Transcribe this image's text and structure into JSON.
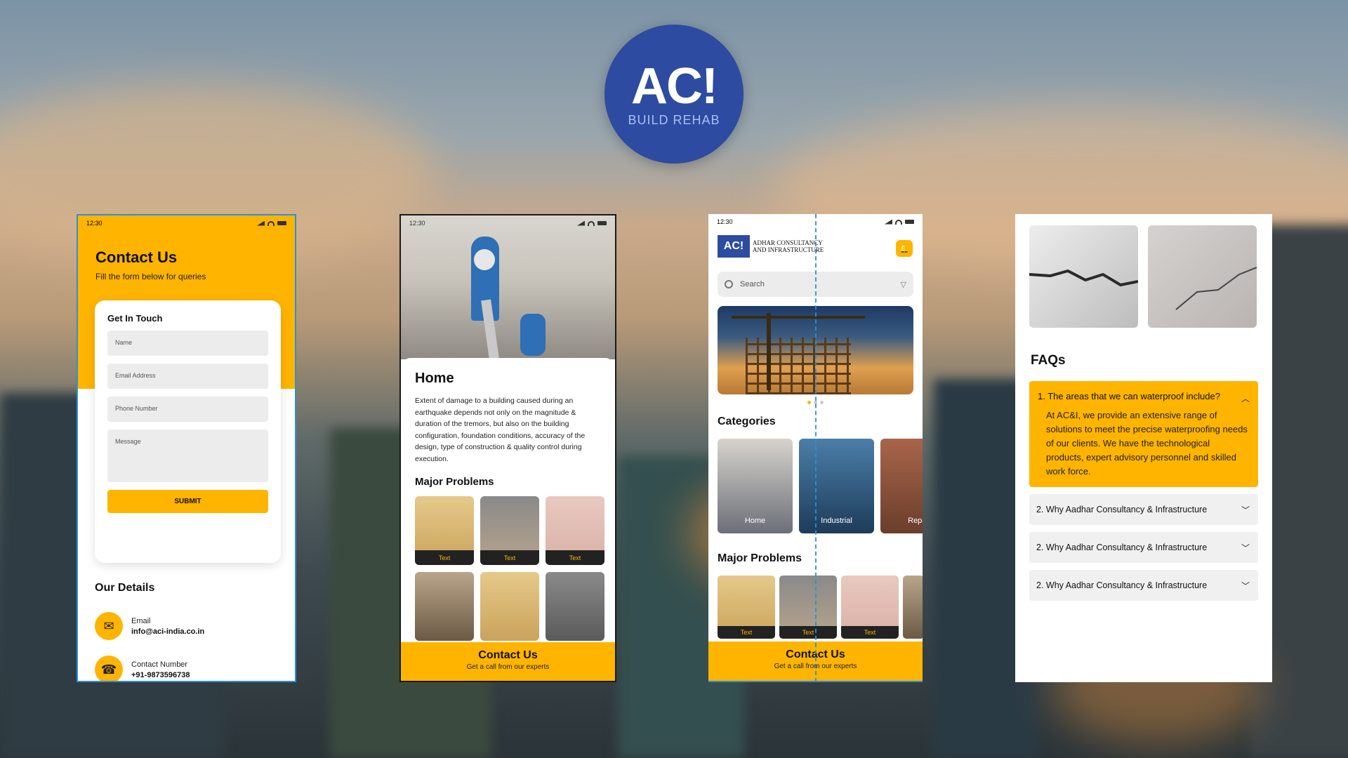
{
  "brand": {
    "logo_mark": "AC!",
    "logo_sub": "BUILD REHAB"
  },
  "status_time": "12:30",
  "contact_screen": {
    "title": "Contact Us",
    "subtitle": "Fill the form below for queries",
    "form_title": "Get In Touch",
    "fields": {
      "name": "Name",
      "email": "Email Address",
      "phone": "Phone Number",
      "message": "Message"
    },
    "submit": "SUBMIT",
    "details_title": "Our Details",
    "email_label": "Email",
    "email_value": "info@aci-india.co.in",
    "phone_label": "Contact Number",
    "phone_value": "+91-9873596738"
  },
  "home_screen": {
    "title": "Home",
    "description": "Extent of damage to a building caused during an earthquake depends not only on the magnitude & duration of the tremors, but also on the building configuration, foundation conditions, accuracy of the design, type of construction & quality control during execution.",
    "major_problems_title": "Major Problems",
    "thumb_labels": [
      "Text",
      "Text",
      "Text"
    ],
    "contact_title": "Contact Us",
    "contact_sub": "Get a call from our experts"
  },
  "categories_screen": {
    "brand_logo": "AC!",
    "brand_name_1": "ADHAR CONSULTANCY",
    "brand_name_2": "AND INFRASTRUCTURE",
    "search_placeholder": "Search",
    "categories_title": "Categories",
    "categories": [
      "Home",
      "Industrial",
      "Repai"
    ],
    "major_problems_title": "Major Problems",
    "problem_labels": [
      "Text",
      "Text",
      "Text"
    ],
    "contact_title": "Contact Us",
    "contact_sub": "Get a call from our experts"
  },
  "faq_screen": {
    "title": "FAQs",
    "open_question": "1. The areas that we can waterproof include?",
    "open_answer": "At AC&I, we provide an extensive range of solutions to meet the precise waterproofing needs of our clients. We have the technological products, expert advisory personnel and skilled work force.",
    "questions": [
      "2. Why Aadhar Consultancy & Infrastructure",
      "2. Why Aadhar Consultancy & Infrastructure",
      "2. Why Aadhar Consultancy & Infrastructure"
    ]
  },
  "colors": {
    "accent": "#ffb400",
    "brand_blue": "#2d4ba0",
    "guide_blue": "#2e8fd6"
  },
  "icons": [
    "mail-icon",
    "phone-icon",
    "bell-icon",
    "search-icon",
    "filter-icon",
    "chevron-up-icon",
    "chevron-down-icon"
  ]
}
